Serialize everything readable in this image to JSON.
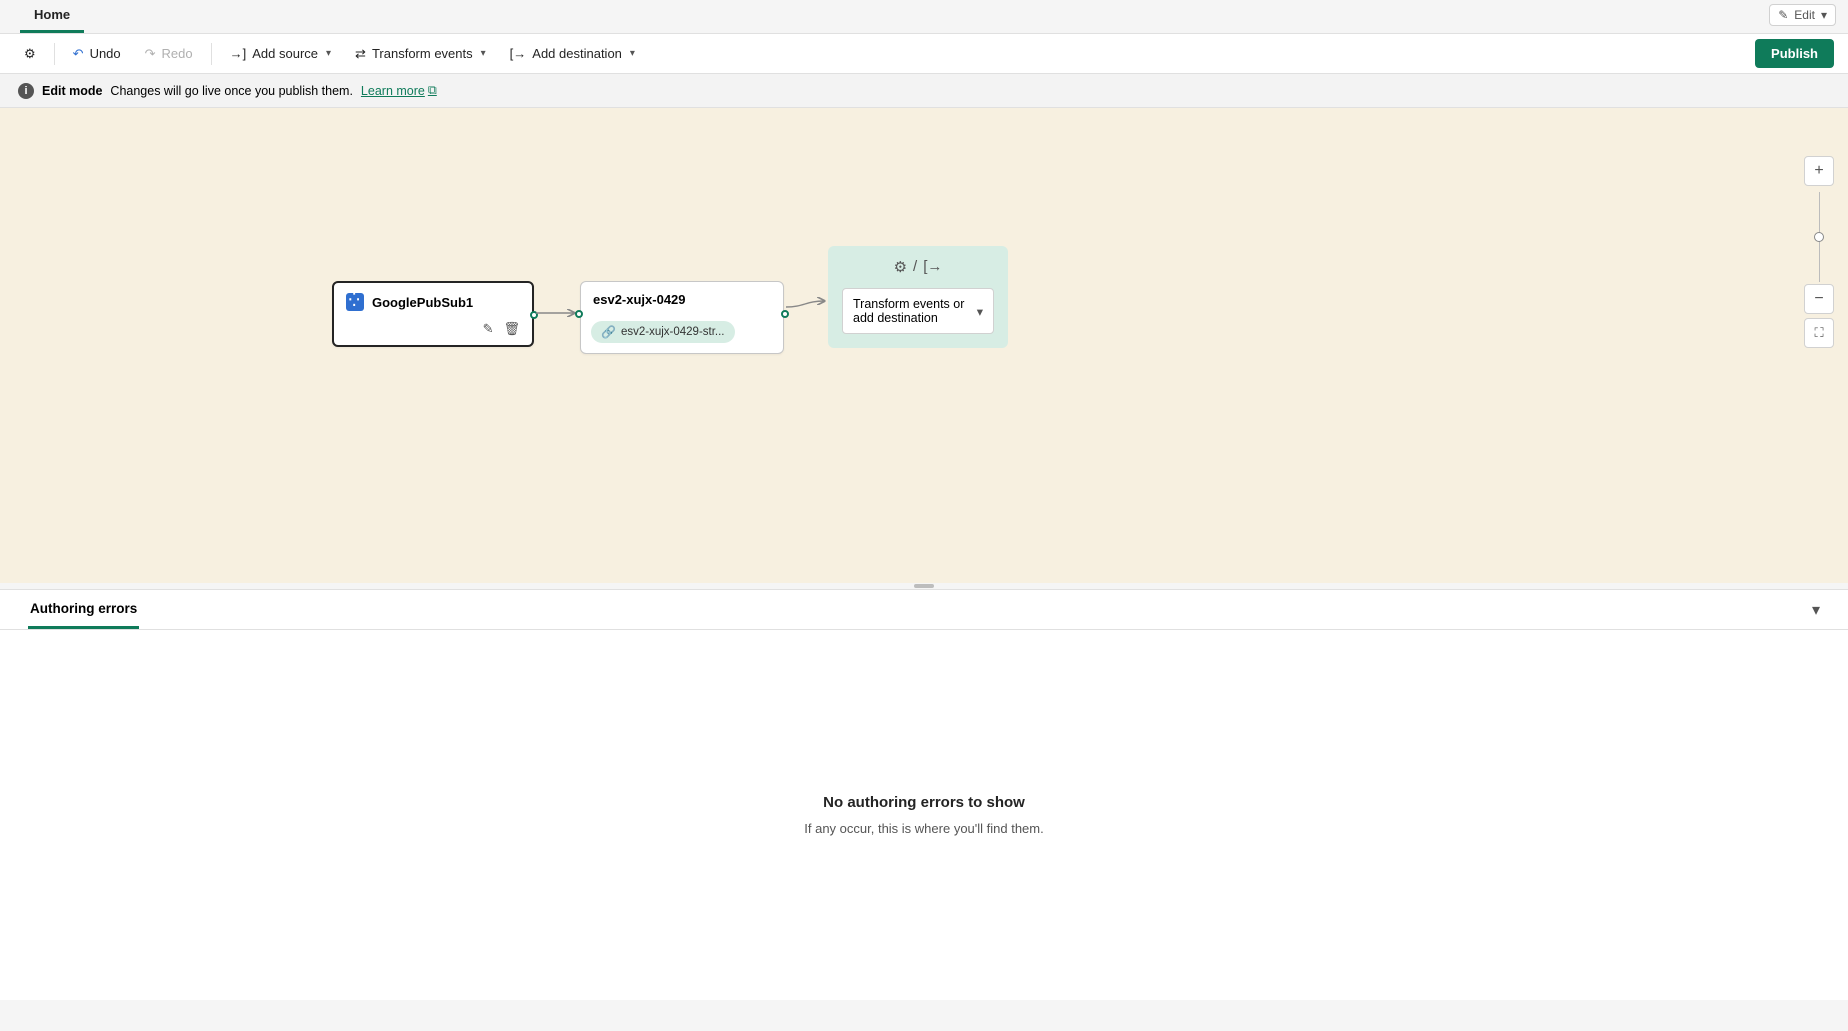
{
  "tabs": {
    "home": "Home"
  },
  "editMenu": {
    "label": "Edit"
  },
  "toolbar": {
    "undo": "Undo",
    "redo": "Redo",
    "addSource": "Add source",
    "transformEvents": "Transform events",
    "addDestination": "Add destination",
    "publish": "Publish"
  },
  "infoBar": {
    "mode": "Edit mode",
    "message": "Changes will go live once you publish them.",
    "learnMore": "Learn more"
  },
  "nodes": {
    "source": {
      "title": "GooglePubSub1"
    },
    "stream": {
      "title": "esv2-xujx-0429",
      "sub": "esv2-xujx-0429-str..."
    },
    "next": {
      "dropLabel": "Transform events or add destination"
    }
  },
  "bottom": {
    "tab": "Authoring errors",
    "emptyTitle": "No authoring errors to show",
    "emptySub": "If any occur, this is where you'll find them."
  }
}
